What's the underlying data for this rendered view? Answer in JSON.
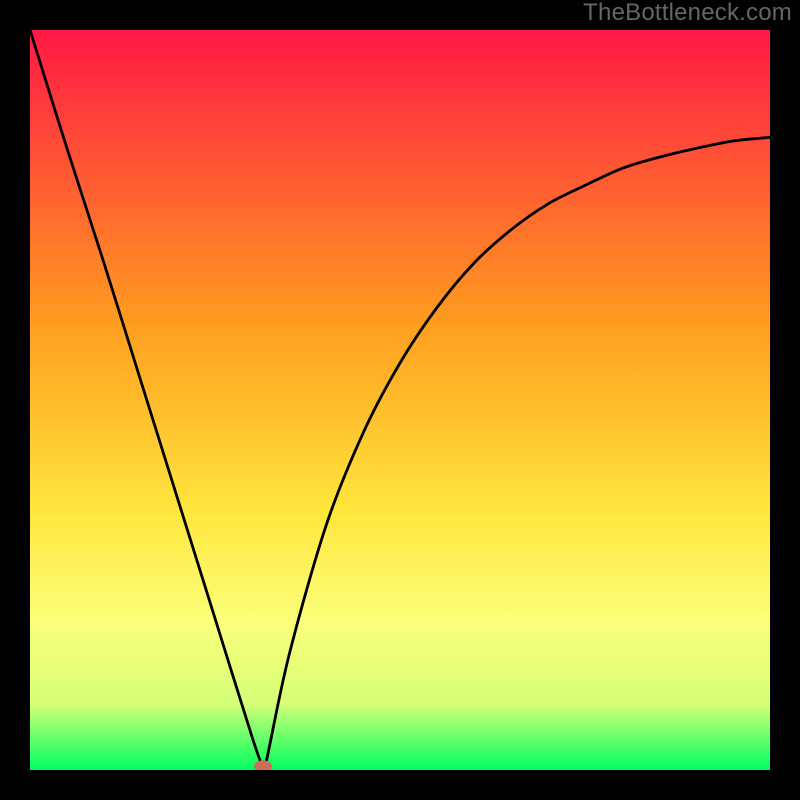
{
  "watermark": "TheBottleneck.com",
  "chart_data": {
    "type": "line",
    "title": "",
    "xlabel": "",
    "ylabel": "",
    "xlim": [
      0,
      100
    ],
    "ylim": [
      0,
      100
    ],
    "series": [
      {
        "name": "bottleneck-curve",
        "x": [
          0,
          5,
          10,
          15,
          20,
          25,
          30,
          31.5,
          32,
          35,
          40,
          45,
          50,
          55,
          60,
          65,
          70,
          75,
          80,
          85,
          90,
          95,
          100
        ],
        "y": [
          100,
          84,
          68.5,
          52.5,
          36.5,
          20.5,
          4.5,
          0.5,
          1.5,
          15.5,
          33,
          45.5,
          55,
          62.5,
          68.5,
          73,
          76.5,
          79,
          81.3,
          82.8,
          84,
          85,
          85.5
        ]
      }
    ],
    "marker": {
      "name": "optimal-point",
      "x": 31.5,
      "y": 0.5,
      "color": "#cc6f59"
    },
    "background_gradient": {
      "top": "#ff1846",
      "mid1": "#ff9e1f",
      "mid2": "#ffe63d",
      "mid3": "#fbff7a",
      "mid4": "#d6ff78",
      "bottom": "#00ff5f"
    }
  }
}
